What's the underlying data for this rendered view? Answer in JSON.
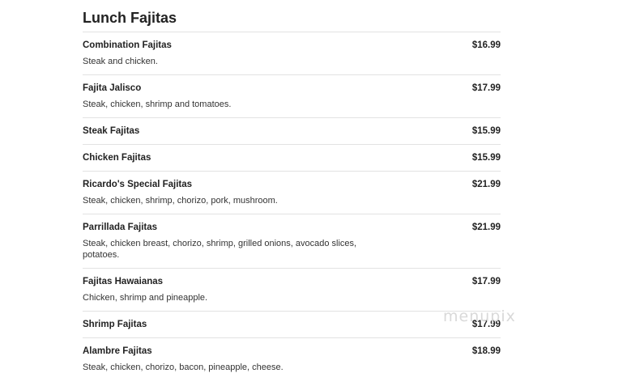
{
  "section": {
    "title": "Lunch Fajitas"
  },
  "items": [
    {
      "name": "Combination Fajitas",
      "price": "$16.99",
      "description": "Steak and chicken."
    },
    {
      "name": "Fajita Jalisco",
      "price": "$17.99",
      "description": "Steak, chicken, shrimp and tomatoes."
    },
    {
      "name": "Steak Fajitas",
      "price": "$15.99",
      "description": ""
    },
    {
      "name": "Chicken Fajitas",
      "price": "$15.99",
      "description": ""
    },
    {
      "name": "Ricardo's Special Fajitas",
      "price": "$21.99",
      "description": "Steak, chicken, shrimp, chorizo, pork, mushroom."
    },
    {
      "name": "Parrillada Fajitas",
      "price": "$21.99",
      "description": "Steak, chicken breast, chorizo, shrimp, grilled onions, avocado slices, potatoes."
    },
    {
      "name": "Fajitas Hawaianas",
      "price": "$17.99",
      "description": "Chicken, shrimp and pineapple."
    },
    {
      "name": "Shrimp Fajitas",
      "price": "$17.99",
      "description": ""
    },
    {
      "name": "Alambre Fajitas",
      "price": "$18.99",
      "description": "Steak, chicken, chorizo, bacon, pineapple, cheese."
    }
  ],
  "watermark": "menupix"
}
